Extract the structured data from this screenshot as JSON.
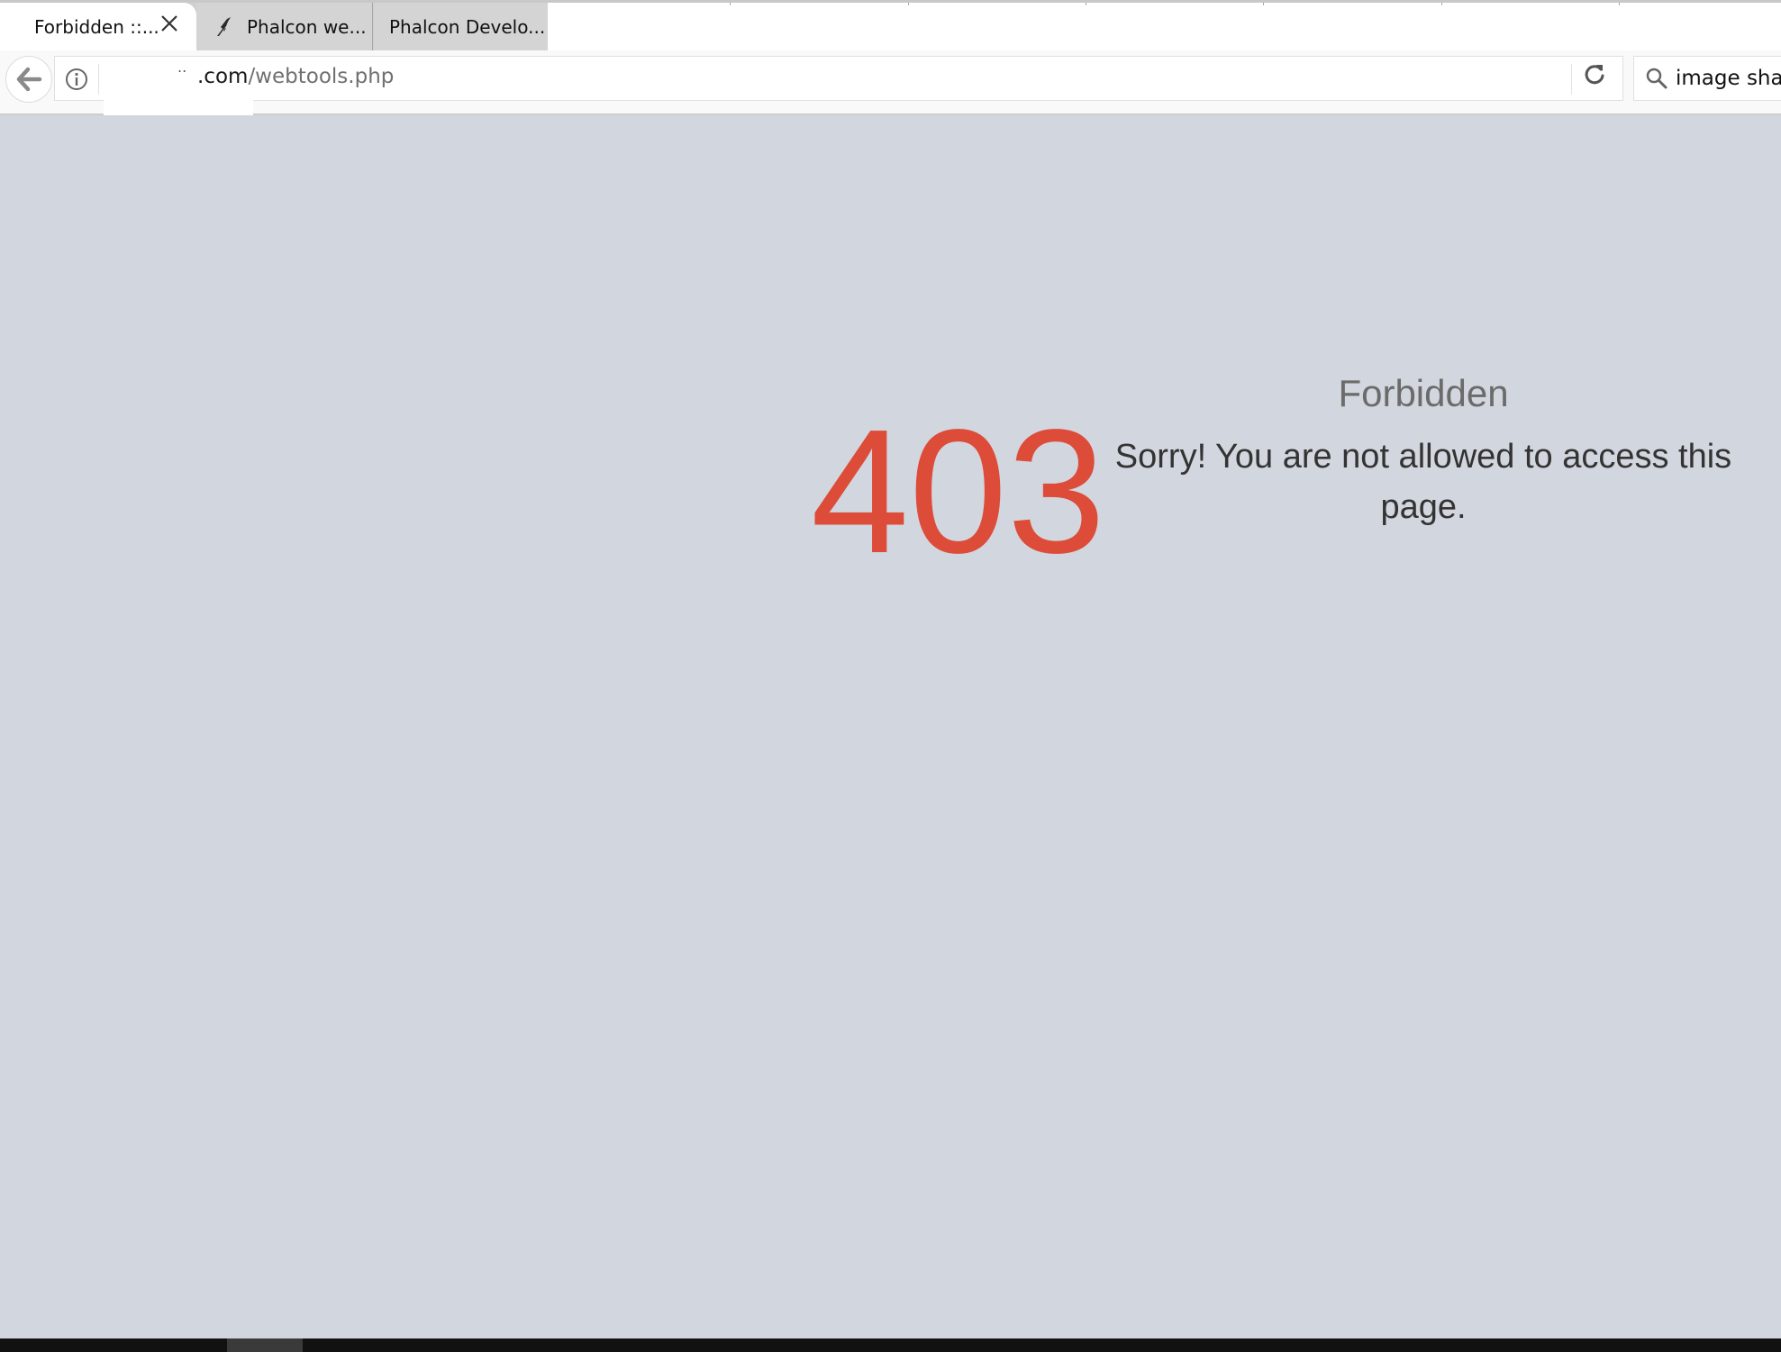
{
  "tabs": [
    {
      "title": "Forbidden ::...",
      "active": true
    },
    {
      "title": "Phalcon we...",
      "active": false,
      "favicon": "phalcon-bird-icon"
    },
    {
      "title": "Phalcon Develo...",
      "active": false
    }
  ],
  "navbar": {
    "url_dots": "..",
    "url_host": ".com",
    "url_path": "/webtools.php",
    "search_text": "image shar"
  },
  "page": {
    "code": "403",
    "title": "Forbidden",
    "message": "Sorry! You are not allowed to access this page."
  },
  "colors": {
    "page_background": "#d2d6de",
    "error_code": "#dd4b39",
    "title": "#6b6b6b",
    "message": "#333333"
  },
  "icons": [
    "close-icon",
    "phalcon-bird-icon",
    "back-arrow-icon",
    "info-icon",
    "reload-icon",
    "search-icon"
  ]
}
